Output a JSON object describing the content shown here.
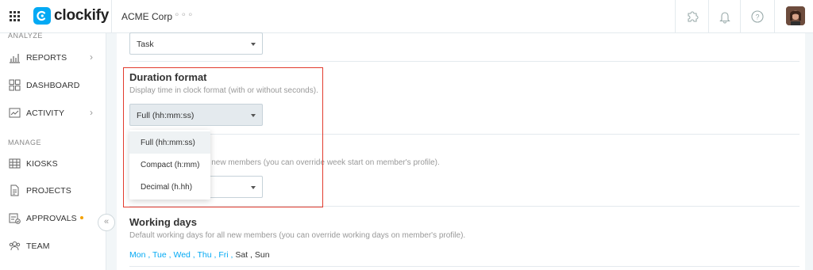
{
  "app": {
    "logo_text": "clockify",
    "brand_color": "#03a9f4"
  },
  "header": {
    "workspace": "ACME Corp",
    "workspace_more": "∘∘∘",
    "icons": [
      "apps-grid-icon",
      "puzzle-icon",
      "bell-icon",
      "help-icon",
      "user-avatar"
    ]
  },
  "sidebar": {
    "sections": [
      {
        "title": "ANALYZE"
      },
      {
        "title": "MANAGE"
      }
    ],
    "items": [
      {
        "label": "REPORTS",
        "icon": "reports-icon",
        "chevron": "›"
      },
      {
        "label": "DASHBOARD",
        "icon": "dashboard-icon"
      },
      {
        "label": "ACTIVITY",
        "icon": "activity-icon",
        "chevron": "›"
      },
      {
        "label": "KIOSKS",
        "icon": "kiosks-icon"
      },
      {
        "label": "PROJECTS",
        "icon": "projects-icon"
      },
      {
        "label": "APPROVALS",
        "icon": "approvals-icon"
      },
      {
        "label": "TEAM",
        "icon": "team-icon"
      }
    ],
    "collapse_label": "«"
  },
  "settings": {
    "group_by_value": "Task",
    "duration_format": {
      "title": "Duration format",
      "description": "Display time in clock format (with or without seconds).",
      "value": "Full (hh:mm:ss)",
      "options": [
        "Full (hh:mm:ss)",
        "Compact (h:mm)",
        "Decimal (h.hh)"
      ]
    },
    "week_start": {
      "description_partial": "ll new members (you can override week start on member's profile)."
    },
    "working_days": {
      "title": "Working days",
      "description": "Default working days for all new members (you can override working days on member's profile).",
      "days": [
        {
          "label": "Mon",
          "on": true
        },
        {
          "label": "Tue",
          "on": true
        },
        {
          "label": "Wed",
          "on": true
        },
        {
          "label": "Thu",
          "on": true
        },
        {
          "label": "Fri",
          "on": true
        },
        {
          "label": "Sat",
          "on": false
        },
        {
          "label": "Sun",
          "on": false
        }
      ],
      "separator": " , "
    }
  },
  "highlight_color": "#e23b2e"
}
